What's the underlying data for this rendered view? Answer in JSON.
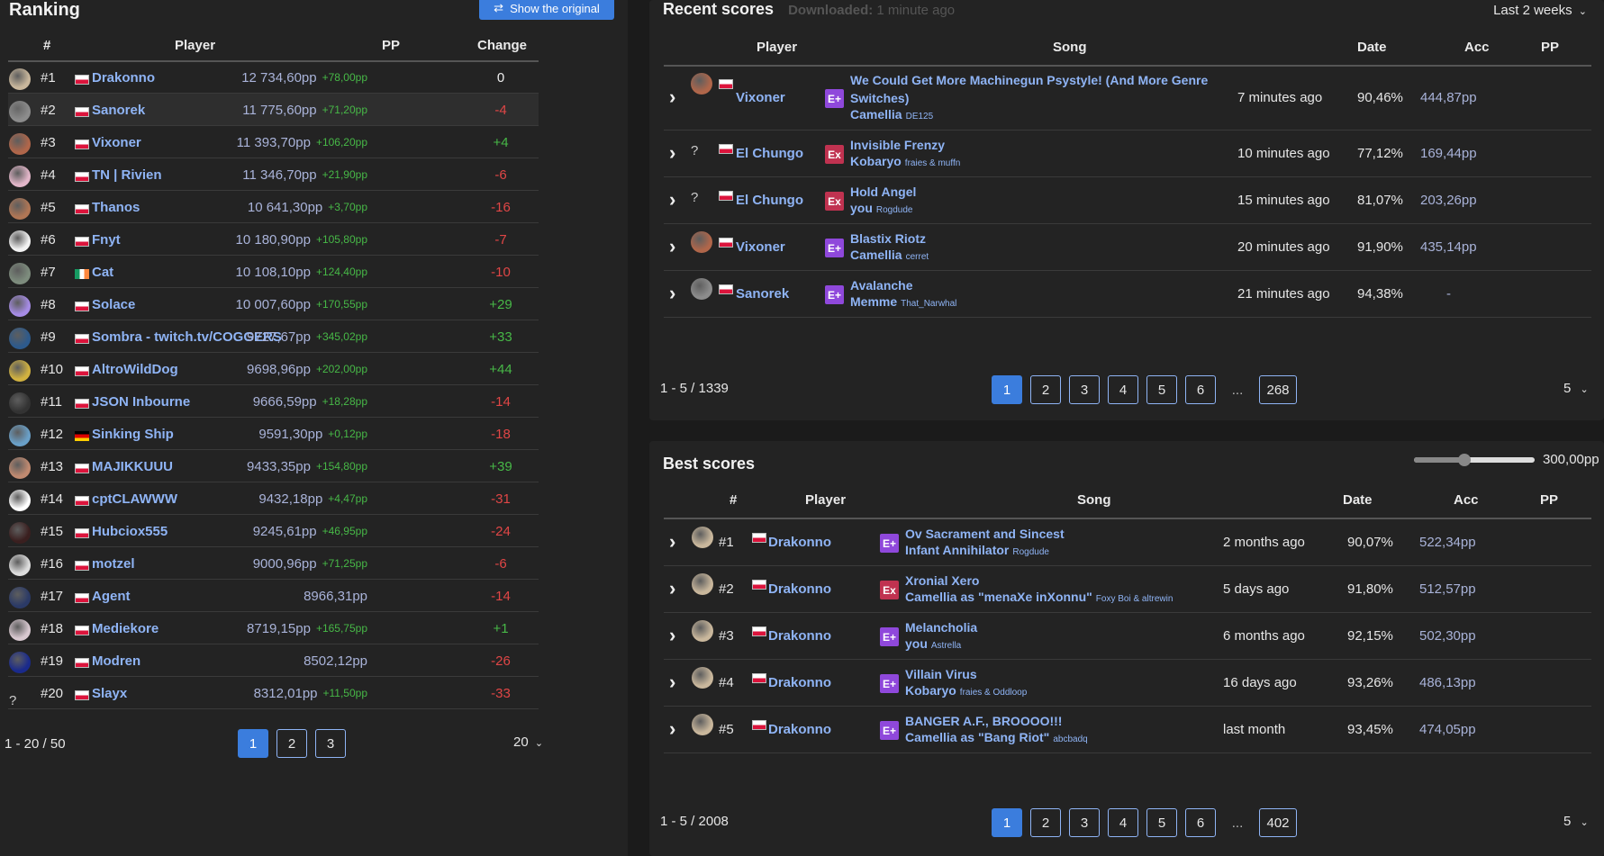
{
  "ranking": {
    "title": "Ranking",
    "show_original": "Show the original",
    "headers": {
      "rank": "#",
      "player": "Player",
      "pp": "PP",
      "change": "Change"
    },
    "rows": [
      {
        "rank": "#1",
        "name": "Drakonno",
        "flag": "pl",
        "pp": "12 734,60pp",
        "gain": "+78,00pp",
        "change": "0",
        "sign": "zero",
        "avatar": "#c9b79c"
      },
      {
        "rank": "#2",
        "name": "Sanorek",
        "flag": "pl",
        "pp": "11 775,60pp",
        "gain": "+71,20pp",
        "change": "-4",
        "sign": "neg",
        "avatar": "#8c8c8c"
      },
      {
        "rank": "#3",
        "name": "Vixoner",
        "flag": "pl",
        "pp": "11 393,70pp",
        "gain": "+106,20pp",
        "change": "+4",
        "sign": "pos",
        "avatar": "#b0664a"
      },
      {
        "rank": "#4",
        "name": "TN | Rivien",
        "flag": "pl",
        "pp": "11 346,70pp",
        "gain": "+21,90pp",
        "change": "-6",
        "sign": "neg",
        "avatar": "#e2b6c9"
      },
      {
        "rank": "#5",
        "name": "Thanos",
        "flag": "pl",
        "pp": "10 641,30pp",
        "gain": "+3,70pp",
        "change": "-16",
        "sign": "neg",
        "avatar": "#b07655"
      },
      {
        "rank": "#6",
        "name": "Fnyt",
        "flag": "pl",
        "pp": "10 180,90pp",
        "gain": "+105,80pp",
        "change": "-7",
        "sign": "neg",
        "avatar": "#f2f2f2"
      },
      {
        "rank": "#7",
        "name": "Cat",
        "flag": "ie",
        "pp": "10 108,10pp",
        "gain": "+124,40pp",
        "change": "-10",
        "sign": "neg",
        "avatar": "#7d8c7d"
      },
      {
        "rank": "#8",
        "name": "Solace",
        "flag": "pl",
        "pp": "10 007,60pp",
        "gain": "+170,55pp",
        "change": "+29",
        "sign": "pos",
        "avatar": "#a68ce6"
      },
      {
        "rank": "#9",
        "name": "Sombra - twitch.tv/COGGERS",
        "flag": "pl",
        "pp": "9727,67pp",
        "gain": "+345,02pp",
        "change": "+33",
        "sign": "pos",
        "avatar": "#2d5a8c"
      },
      {
        "rank": "#10",
        "name": "AltroWildDog",
        "flag": "pl",
        "pp": "9698,96pp",
        "gain": "+202,00pp",
        "change": "+44",
        "sign": "pos",
        "avatar": "#d1b240"
      },
      {
        "rank": "#11",
        "name": "JSON Inbourne",
        "flag": "pl",
        "pp": "9666,59pp",
        "gain": "+18,28pp",
        "change": "-14",
        "sign": "neg",
        "avatar": "#333333"
      },
      {
        "rank": "#12",
        "name": "Sinking Ship",
        "flag": "de",
        "pp": "9591,30pp",
        "gain": "+0,12pp",
        "change": "-18",
        "sign": "neg",
        "avatar": "#6aa0c8"
      },
      {
        "rank": "#13",
        "name": "MAJIKKUUU",
        "flag": "pl",
        "pp": "9433,35pp",
        "gain": "+154,80pp",
        "change": "+39",
        "sign": "pos",
        "avatar": "#c08a70"
      },
      {
        "rank": "#14",
        "name": "cptCLAWWW",
        "flag": "pl",
        "pp": "9432,18pp",
        "gain": "+4,47pp",
        "change": "-31",
        "sign": "neg",
        "avatar": "#ffffff"
      },
      {
        "rank": "#15",
        "name": "Hubciox555",
        "flag": "pl",
        "pp": "9245,61pp",
        "gain": "+46,95pp",
        "change": "-24",
        "sign": "neg",
        "avatar": "#3a1f1f"
      },
      {
        "rank": "#16",
        "name": "motzel",
        "flag": "pl",
        "pp": "9000,96pp",
        "gain": "+71,25pp",
        "change": "-6",
        "sign": "neg",
        "avatar": "#dddddd"
      },
      {
        "rank": "#17",
        "name": "Agent",
        "flag": "pl",
        "pp": "8966,31pp",
        "gain": "",
        "change": "-14",
        "sign": "neg",
        "avatar": "#2b3a66"
      },
      {
        "rank": "#18",
        "name": "Mediekore",
        "flag": "pl",
        "pp": "8719,15pp",
        "gain": "+165,75pp",
        "change": "+1",
        "sign": "pos",
        "avatar": "#d8c8d0"
      },
      {
        "rank": "#19",
        "name": "Modren",
        "flag": "pl",
        "pp": "8502,12pp",
        "gain": "",
        "change": "-26",
        "sign": "neg",
        "avatar": "#1a2a8c"
      },
      {
        "rank": "#20",
        "name": "Slayx",
        "flag": "pl",
        "pp": "8312,01pp",
        "gain": "+11,50pp",
        "change": "-33",
        "sign": "neg",
        "avatar": "none"
      }
    ],
    "count": "1 - 20 / 50",
    "pages": [
      "1",
      "2",
      "3"
    ],
    "per_page": "20"
  },
  "recent": {
    "title": "Recent scores",
    "downloaded_label": "Downloaded:",
    "downloaded_value": "1 minute ago",
    "period": "Last 2 weeks",
    "headers": {
      "player": "Player",
      "song": "Song",
      "date": "Date",
      "acc": "Acc",
      "pp": "PP"
    },
    "rows": [
      {
        "player": "Vixoner",
        "avatar": "#b0664a",
        "diff": "E+",
        "song": "We Could Get More Machinegun Psystyle! (And More Genre Switches)",
        "artist": "Camellia",
        "mapper": "DE125",
        "date": "7 minutes ago",
        "acc": "90,46%",
        "pp": "444,87pp"
      },
      {
        "player": "El Chungo",
        "avatar": "none",
        "diff": "Ex",
        "song": "Invisible Frenzy",
        "artist": "Kobaryo",
        "mapper": "fraies & muffn",
        "date": "10 minutes ago",
        "acc": "77,12%",
        "pp": "169,44pp"
      },
      {
        "player": "El Chungo",
        "avatar": "none",
        "diff": "Ex",
        "song": "Hold Angel",
        "artist": "you",
        "mapper": "Rogdude",
        "date": "15 minutes ago",
        "acc": "81,07%",
        "pp": "203,26pp"
      },
      {
        "player": "Vixoner",
        "avatar": "#b0664a",
        "diff": "E+",
        "song": "Blastix Riotz",
        "artist": "Camellia",
        "mapper": "cerret",
        "date": "20 minutes ago",
        "acc": "91,90%",
        "pp": "435,14pp"
      },
      {
        "player": "Sanorek",
        "avatar": "#8c8c8c",
        "diff": "E+",
        "song": "Avalanche",
        "artist": "Memme",
        "mapper": "That_Narwhal",
        "date": "21 minutes ago",
        "acc": "94,38%",
        "pp": "-"
      }
    ],
    "count": "1 - 5 / 1339",
    "pages": [
      "1",
      "2",
      "3",
      "4",
      "5",
      "6",
      "...",
      "268"
    ],
    "per_page": "5"
  },
  "best": {
    "title": "Best scores",
    "threshold": "300,00pp",
    "threshold_fraction": 0.42,
    "headers": {
      "rank": "#",
      "player": "Player",
      "song": "Song",
      "date": "Date",
      "acc": "Acc",
      "pp": "PP"
    },
    "rows": [
      {
        "rank": "#1",
        "player": "Drakonno",
        "diff": "E+",
        "song": "Ov Sacrament and Sincest",
        "artist": "Infant Annihilator",
        "mapper": "Rogdude",
        "date": "2 months ago",
        "acc": "90,07%",
        "pp": "522,34pp"
      },
      {
        "rank": "#2",
        "player": "Drakonno",
        "diff": "Ex",
        "song": "Xronial Xero",
        "artist": "Camellia as \"menaXe inXonnu\"",
        "mapper": "Foxy Boi & altrewin",
        "date": "5 days ago",
        "acc": "91,80%",
        "pp": "512,57pp"
      },
      {
        "rank": "#3",
        "player": "Drakonno",
        "diff": "E+",
        "song": "Melancholia",
        "artist": "you",
        "mapper": "Astrella",
        "date": "6 months ago",
        "acc": "92,15%",
        "pp": "502,30pp"
      },
      {
        "rank": "#4",
        "player": "Drakonno",
        "diff": "E+",
        "song": "Villain Virus",
        "artist": "Kobaryo",
        "mapper": "fraies & Oddloop",
        "date": "16 days ago",
        "acc": "93,26%",
        "pp": "486,13pp"
      },
      {
        "rank": "#5",
        "player": "Drakonno",
        "diff": "E+",
        "song": "BANGER A.F., BROOOO!!!",
        "artist": "Camellia as \"Bang Riot\"",
        "mapper": "abcbadq",
        "date": "last month",
        "acc": "93,45%",
        "pp": "474,05pp"
      }
    ],
    "count": "1 - 5 / 2008",
    "pages": [
      "1",
      "2",
      "3",
      "4",
      "5",
      "6",
      "...",
      "402"
    ],
    "per_page": "5"
  },
  "colors": {
    "accent": "#3b7ddd",
    "link": "#8fb4f5",
    "positive": "#47b847",
    "negative": "#e04646",
    "expert_plus": "#8f48db",
    "expert": "#c03250"
  }
}
